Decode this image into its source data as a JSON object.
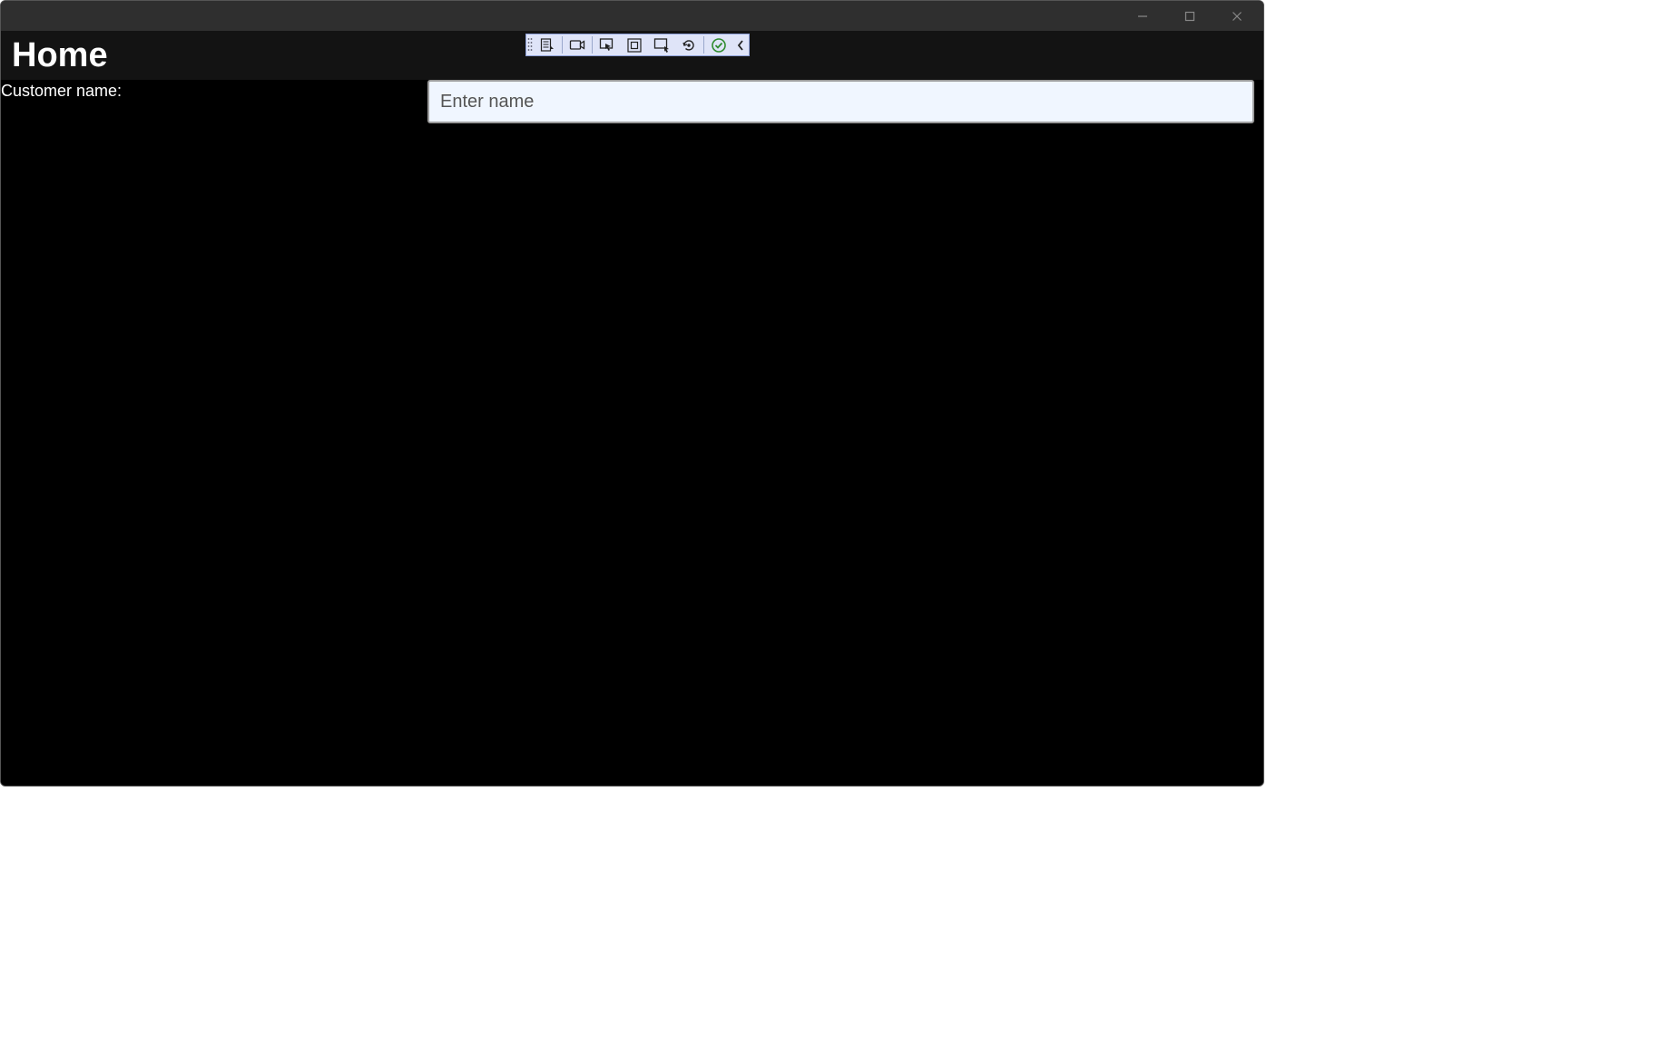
{
  "window": {
    "controls": {
      "minimize": "minimize",
      "maximize": "maximize",
      "close": "close"
    }
  },
  "header": {
    "title": "Home"
  },
  "debug_toolbar": {
    "items": [
      "live-visual-tree-icon",
      "record-icon",
      "select-element-icon",
      "display-layout-adorners-icon",
      "track-focused-element-icon",
      "hot-reload-icon",
      "accessibility-check-icon",
      "collapse-icon"
    ]
  },
  "form": {
    "customer_name": {
      "label": "Customer name:",
      "placeholder": "Enter name",
      "value": ""
    }
  }
}
